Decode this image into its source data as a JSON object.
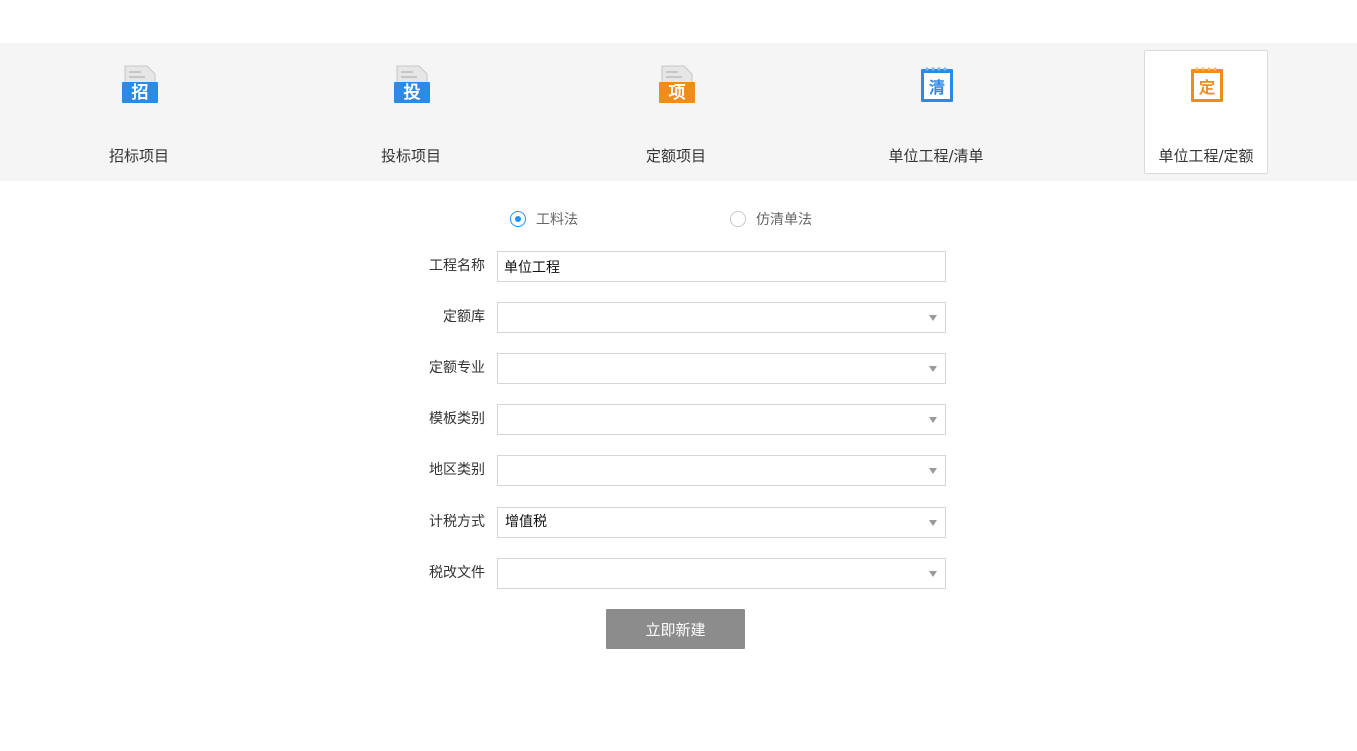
{
  "tabs": [
    {
      "glyph": "招",
      "label": "招标项目",
      "color": "#2b8ae6"
    },
    {
      "glyph": "投",
      "label": "投标项目",
      "color": "#2b8ae6"
    },
    {
      "glyph": "项",
      "label": "定额项目",
      "color": "#f28c18"
    },
    {
      "glyph": "清",
      "label": "单位工程/清单",
      "color": "#2b8ae6"
    },
    {
      "glyph": "定",
      "label": "单位工程/定额",
      "color": "#f28c18"
    }
  ],
  "method": {
    "option1": "工料法",
    "option2": "仿清单法",
    "selected": "工料法"
  },
  "form": {
    "project_name": {
      "label": "工程名称",
      "value": "单位工程"
    },
    "quota_lib": {
      "label": "定额库",
      "value": ""
    },
    "quota_major": {
      "label": "定额专业",
      "value": ""
    },
    "template_type": {
      "label": "模板类别",
      "value": ""
    },
    "region_type": {
      "label": "地区类别",
      "value": ""
    },
    "tax_method": {
      "label": "计税方式",
      "value": "增值税"
    },
    "tax_file": {
      "label": "税改文件",
      "value": ""
    }
  },
  "submit_label": "立即新建",
  "colors": {
    "accent": "#1e90ff",
    "blue_icon": "#2b8ae6",
    "orange_icon": "#f28c18",
    "button": "#8c8c8c"
  }
}
